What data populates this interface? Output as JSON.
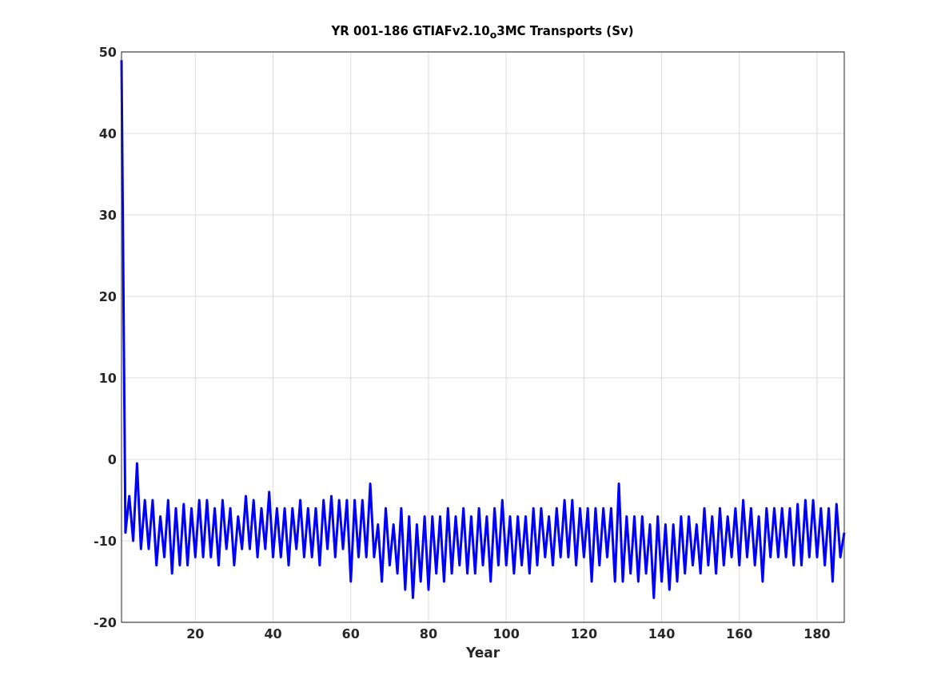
{
  "chart_data": {
    "type": "line",
    "grid": true,
    "title": "YR 001-186 GTIAFv2.10$_{o}$3MC Transports (Sv)",
    "xlabel": "Year",
    "xlim": [
      1,
      187
    ],
    "ylim": [
      -20,
      50
    ],
    "xticks": [
      20,
      40,
      60,
      80,
      100,
      120,
      140,
      160,
      180
    ],
    "yticks": [
      -20,
      -10,
      0,
      10,
      20,
      30,
      40,
      50
    ],
    "x": [
      1,
      2,
      3,
      4,
      5,
      6,
      7,
      8,
      9,
      10,
      11,
      12,
      13,
      14,
      15,
      16,
      17,
      18,
      19,
      20,
      21,
      22,
      23,
      24,
      25,
      26,
      27,
      28,
      29,
      30,
      31,
      32,
      33,
      34,
      35,
      36,
      37,
      38,
      39,
      40,
      41,
      42,
      43,
      44,
      45,
      46,
      47,
      48,
      49,
      50,
      51,
      52,
      53,
      54,
      55,
      56,
      57,
      58,
      59,
      60,
      61,
      62,
      63,
      64,
      65,
      66,
      67,
      68,
      69,
      70,
      71,
      72,
      73,
      74,
      75,
      76,
      77,
      78,
      79,
      80,
      81,
      82,
      83,
      84,
      85,
      86,
      87,
      88,
      89,
      90,
      91,
      92,
      93,
      94,
      95,
      96,
      97,
      98,
      99,
      100,
      101,
      102,
      103,
      104,
      105,
      106,
      107,
      108,
      109,
      110,
      111,
      112,
      113,
      114,
      115,
      116,
      117,
      118,
      119,
      120,
      121,
      122,
      123,
      124,
      125,
      126,
      127,
      128,
      129,
      130,
      131,
      132,
      133,
      134,
      135,
      136,
      137,
      138,
      139,
      140,
      141,
      142,
      143,
      144,
      145,
      146,
      147,
      148,
      149,
      150,
      151,
      152,
      153,
      154,
      155,
      156,
      157,
      158,
      159,
      160,
      161,
      162,
      163,
      164,
      165,
      166,
      167,
      168,
      169,
      170,
      171,
      172,
      173,
      174,
      175,
      176,
      177,
      178,
      179,
      180,
      181,
      182,
      183,
      184,
      185,
      186,
      187
    ],
    "series": [
      {
        "color": "#0000ff",
        "values": [
          49,
          -9,
          -4.5,
          -10,
          -0.5,
          -11,
          -5,
          -11,
          -5,
          -13,
          -7,
          -12,
          -5,
          -14,
          -6,
          -13,
          -5.5,
          -13,
          -6,
          -12,
          -5,
          -12,
          -5,
          -12,
          -6,
          -13,
          -5,
          -11,
          -6,
          -13,
          -7,
          -11,
          -4.5,
          -11,
          -5,
          -12,
          -6,
          -11,
          -4,
          -12,
          -6,
          -12,
          -6,
          -13,
          -6,
          -11,
          -5,
          -12,
          -6,
          -12,
          -6,
          -13,
          -5,
          -11,
          -4.5,
          -12,
          -5,
          -11,
          -5,
          -15,
          -5,
          -12,
          -5,
          -12,
          -3,
          -12,
          -8,
          -15,
          -6,
          -13,
          -8,
          -14,
          -6,
          -16,
          -7,
          -17,
          -8,
          -15,
          -7,
          -16,
          -7,
          -14,
          -7,
          -15,
          -6,
          -14,
          -7,
          -13,
          -6,
          -14,
          -7,
          -14,
          -6,
          -13,
          -7,
          -15,
          -6,
          -13,
          -5,
          -13,
          -7,
          -14,
          -7,
          -13,
          -7,
          -14,
          -6,
          -13,
          -6,
          -12,
          -7,
          -13,
          -6,
          -12,
          -5,
          -12,
          -5,
          -13,
          -6,
          -12,
          -6,
          -15,
          -6,
          -13,
          -6,
          -12,
          -6,
          -15,
          -3,
          -15,
          -7,
          -14,
          -7,
          -15,
          -7,
          -14,
          -8,
          -17,
          -7,
          -15,
          -8,
          -16,
          -8,
          -15,
          -7,
          -14,
          -7,
          -13,
          -8,
          -14,
          -6,
          -13,
          -7,
          -14,
          -6,
          -13,
          -7,
          -12,
          -6,
          -13,
          -5,
          -12,
          -6,
          -13,
          -7,
          -15,
          -6,
          -12,
          -6,
          -12,
          -6,
          -12,
          -6,
          -13,
          -5.5,
          -13,
          -5,
          -12,
          -5,
          -12,
          -6,
          -13,
          -6,
          -15,
          -5.5,
          -12,
          -9
        ]
      }
    ]
  }
}
